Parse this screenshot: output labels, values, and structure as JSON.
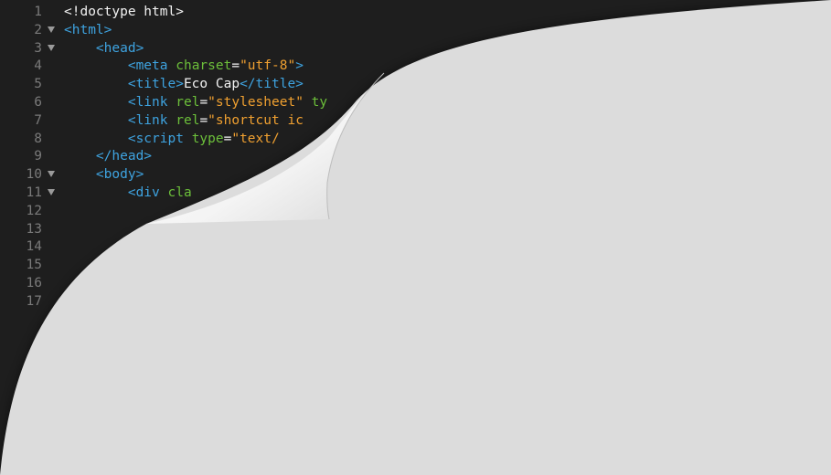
{
  "editor": {
    "lines": [
      {
        "n": "1",
        "fold": false,
        "indent": "",
        "parts": [
          {
            "c": "tx",
            "t": "<!doctype html>"
          }
        ]
      },
      {
        "n": "2",
        "fold": true,
        "indent": "",
        "parts": [
          {
            "c": "tg",
            "t": "<html>"
          }
        ]
      },
      {
        "n": "3",
        "fold": true,
        "indent": "    ",
        "parts": [
          {
            "c": "tg",
            "t": "<head>"
          }
        ]
      },
      {
        "n": "4",
        "fold": false,
        "indent": "        ",
        "parts": [
          {
            "c": "tg",
            "t": "<meta "
          },
          {
            "c": "at",
            "t": "charset"
          },
          {
            "c": "tx",
            "t": "="
          },
          {
            "c": "st",
            "t": "\"utf-8\""
          },
          {
            "c": "tg",
            "t": ">"
          }
        ]
      },
      {
        "n": "5",
        "fold": false,
        "indent": "        ",
        "parts": [
          {
            "c": "tg",
            "t": "<title>"
          },
          {
            "c": "tx",
            "t": "Eco Cap"
          },
          {
            "c": "tg",
            "t": "</title>"
          }
        ]
      },
      {
        "n": "6",
        "fold": false,
        "indent": "        ",
        "parts": [
          {
            "c": "tg",
            "t": "<link "
          },
          {
            "c": "at",
            "t": "rel"
          },
          {
            "c": "tx",
            "t": "="
          },
          {
            "c": "st",
            "t": "\"stylesheet\""
          },
          {
            "c": "at",
            "t": " ty"
          }
        ]
      },
      {
        "n": "7",
        "fold": false,
        "indent": "        ",
        "parts": [
          {
            "c": "tg",
            "t": "<link "
          },
          {
            "c": "at",
            "t": "rel"
          },
          {
            "c": "tx",
            "t": "="
          },
          {
            "c": "st",
            "t": "\"shortcut ic"
          }
        ]
      },
      {
        "n": "8",
        "fold": false,
        "indent": "        ",
        "parts": [
          {
            "c": "tg",
            "t": "<script "
          },
          {
            "c": "at",
            "t": "type"
          },
          {
            "c": "tx",
            "t": "="
          },
          {
            "c": "st",
            "t": "\"text/"
          }
        ]
      },
      {
        "n": "9",
        "fold": false,
        "indent": "    ",
        "parts": [
          {
            "c": "tg",
            "t": "</head>"
          }
        ]
      },
      {
        "n": "10",
        "fold": true,
        "indent": "    ",
        "parts": [
          {
            "c": "tg",
            "t": "<body>"
          }
        ]
      },
      {
        "n": "11",
        "fold": true,
        "indent": "        ",
        "parts": [
          {
            "c": "tg",
            "t": "<div "
          },
          {
            "c": "at",
            "t": "cla"
          }
        ]
      },
      {
        "n": "12",
        "fold": false,
        "indent": "",
        "parts": []
      },
      {
        "n": "13",
        "fold": false,
        "indent": "",
        "parts": []
      },
      {
        "n": "14",
        "fold": false,
        "indent": "",
        "parts": []
      },
      {
        "n": "15",
        "fold": false,
        "indent": "",
        "parts": []
      },
      {
        "n": "16",
        "fold": false,
        "indent": "",
        "parts": []
      },
      {
        "n": "17",
        "fold": false,
        "indent": "",
        "parts": []
      }
    ]
  },
  "colors": {
    "background": "#1e1e1e",
    "page": "#dcdcdc",
    "tag": "#3ea3e0",
    "attribute": "#6cbf3a",
    "string": "#f0a030",
    "line_number": "#7a7a7a"
  }
}
